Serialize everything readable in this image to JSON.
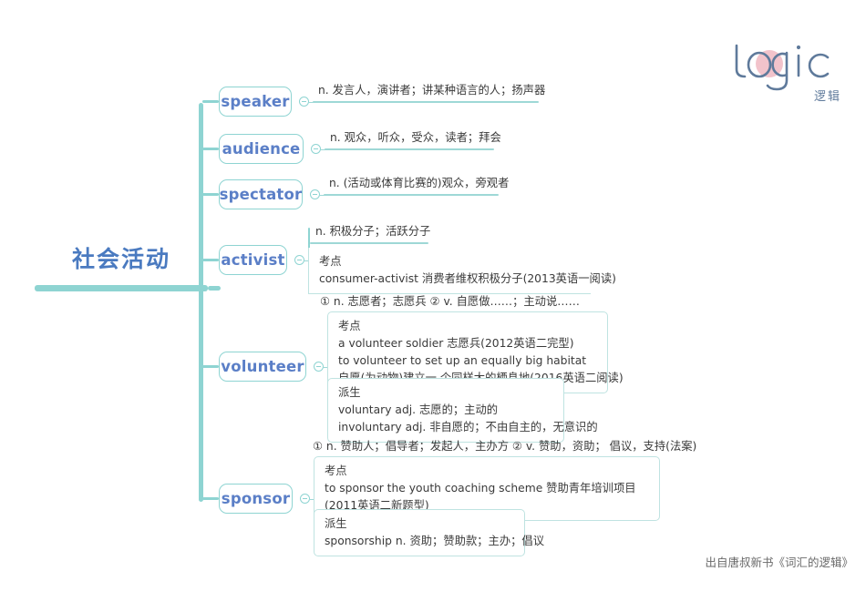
{
  "root": {
    "label": "社会活动",
    "accent": "#8ed4d2",
    "text_color": "#4a7ac0"
  },
  "logo": {
    "wordmark": "logic",
    "cn": "逻辑",
    "blob_color": "#f2c3cb",
    "stroke_color": "#5f7a9b"
  },
  "footer": {
    "text": "出自唐叔新书《词汇的逻辑》"
  },
  "branches": [
    {
      "word": "speaker",
      "definition": "n. 发言人，演讲者；讲某种语言的人；扬声器",
      "details": []
    },
    {
      "word": "audience",
      "definition": "n. 观众，听众，受众，读者；拜会",
      "details": []
    },
    {
      "word": "spectator",
      "definition": "n. (活动或体育比赛的)观众，旁观者",
      "details": []
    },
    {
      "word": "activist",
      "definition": "n. 积极分子；活跃分子",
      "details": [
        {
          "title": "考点",
          "lines": [
            "consumer-activist 消费者维权积极分子(2013英语一阅读)"
          ]
        }
      ]
    },
    {
      "word": "volunteer",
      "definition": "① n. 志愿者；志愿兵 ② v. 自愿做……；主动说……",
      "details": [
        {
          "title": "考点",
          "lines": [
            "a volunteer soldier 志愿兵(2012英语二完型)",
            "to volunteer to set up an equally big habitat",
            "自愿(为动物)建立一 个同样大的栖息地(2016英语二阅读)"
          ]
        },
        {
          "title": "派生",
          "lines": [
            "voluntary adj. 志愿的；主动的",
            "involuntary adj. 非自愿的；不由自主的，无意识的"
          ]
        }
      ]
    },
    {
      "word": "sponsor",
      "definition": "① n. 赞助人；倡导者；发起人，主办方 ② v. 赞助，资助； 倡议，支持(法案)",
      "details": [
        {
          "title": "考点",
          "lines": [
            "to sponsor the youth coaching scheme 赞助青年培训项目(2011英语二新题型)"
          ]
        },
        {
          "title": "派生",
          "lines": [
            "sponsorship n. 资助；赞助款；主办；倡议"
          ]
        }
      ]
    }
  ]
}
